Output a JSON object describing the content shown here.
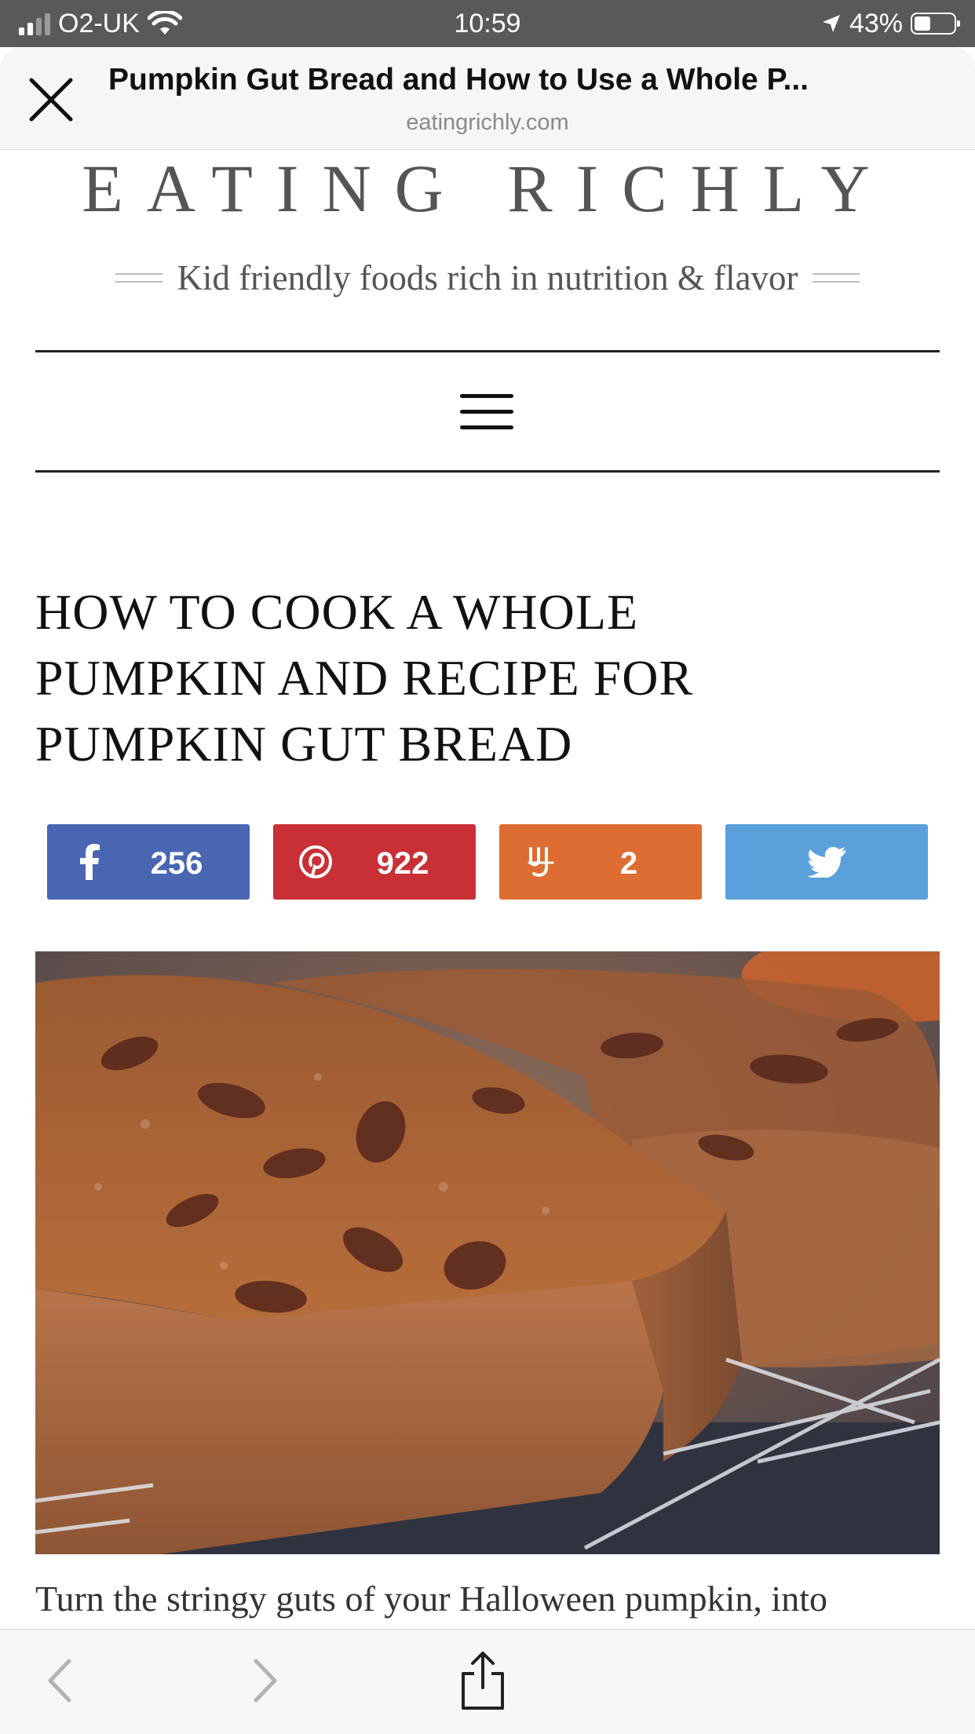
{
  "status_bar": {
    "carrier": "O2-UK",
    "time": "10:59",
    "battery": "43%",
    "battery_level": 0.43
  },
  "browser": {
    "page_title": "Pumpkin Gut Bread and How to Use a Whole P...",
    "domain": "eatingrichly.com"
  },
  "site": {
    "title": "EATING RICHLY",
    "tagline": "Kid friendly foods rich in nutrition & flavor"
  },
  "article": {
    "heading_line1": "HOW TO COOK A WHOLE",
    "heading_line2": "PUMPKIN AND RECIPE FOR",
    "heading_line3": "PUMPKIN GUT BREAD",
    "intro": "Turn the stringy guts of your Halloween pumpkin, into"
  },
  "share": {
    "facebook": {
      "count": "256",
      "color": "#4866b2",
      "icon": "facebook-icon"
    },
    "pinterest": {
      "count": "922",
      "color": "#c83036",
      "icon": "pinterest-icon"
    },
    "yummly": {
      "count": "2",
      "color": "#dd6d32",
      "icon": "yummly-icon"
    },
    "twitter": {
      "count": "",
      "color": "#5aa0db",
      "icon": "twitter-icon"
    }
  },
  "toolbar": {
    "back_icon": "chevron-left-icon",
    "forward_icon": "chevron-right-icon",
    "share_icon": "share-icon"
  }
}
